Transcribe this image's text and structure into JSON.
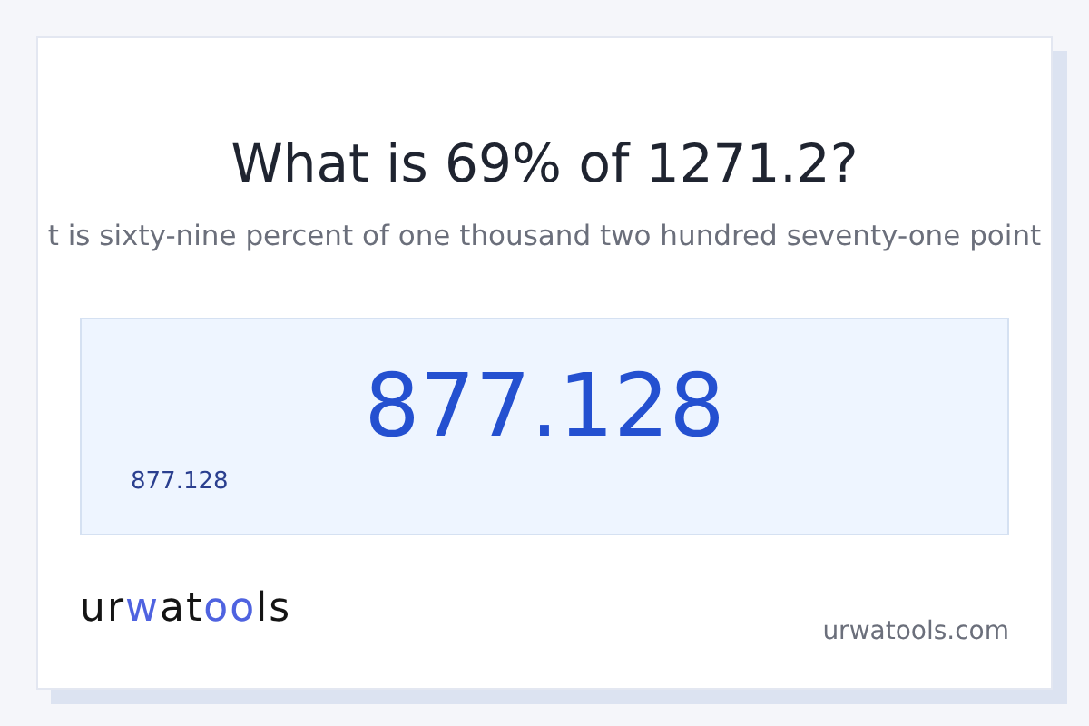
{
  "title": "What is 69% of 1271.2?",
  "subtitle": "t is sixty-nine percent of one thousand two hundred seventy-one point",
  "result": {
    "value": "877.128",
    "caption": "877.128"
  },
  "logo": [
    {
      "text": "ur",
      "accent": false
    },
    {
      "text": "w",
      "accent": true
    },
    {
      "text": "at",
      "accent": false
    },
    {
      "text": "oo",
      "accent": true
    },
    {
      "text": "ls",
      "accent": false
    }
  ],
  "site": "urwatools.com"
}
